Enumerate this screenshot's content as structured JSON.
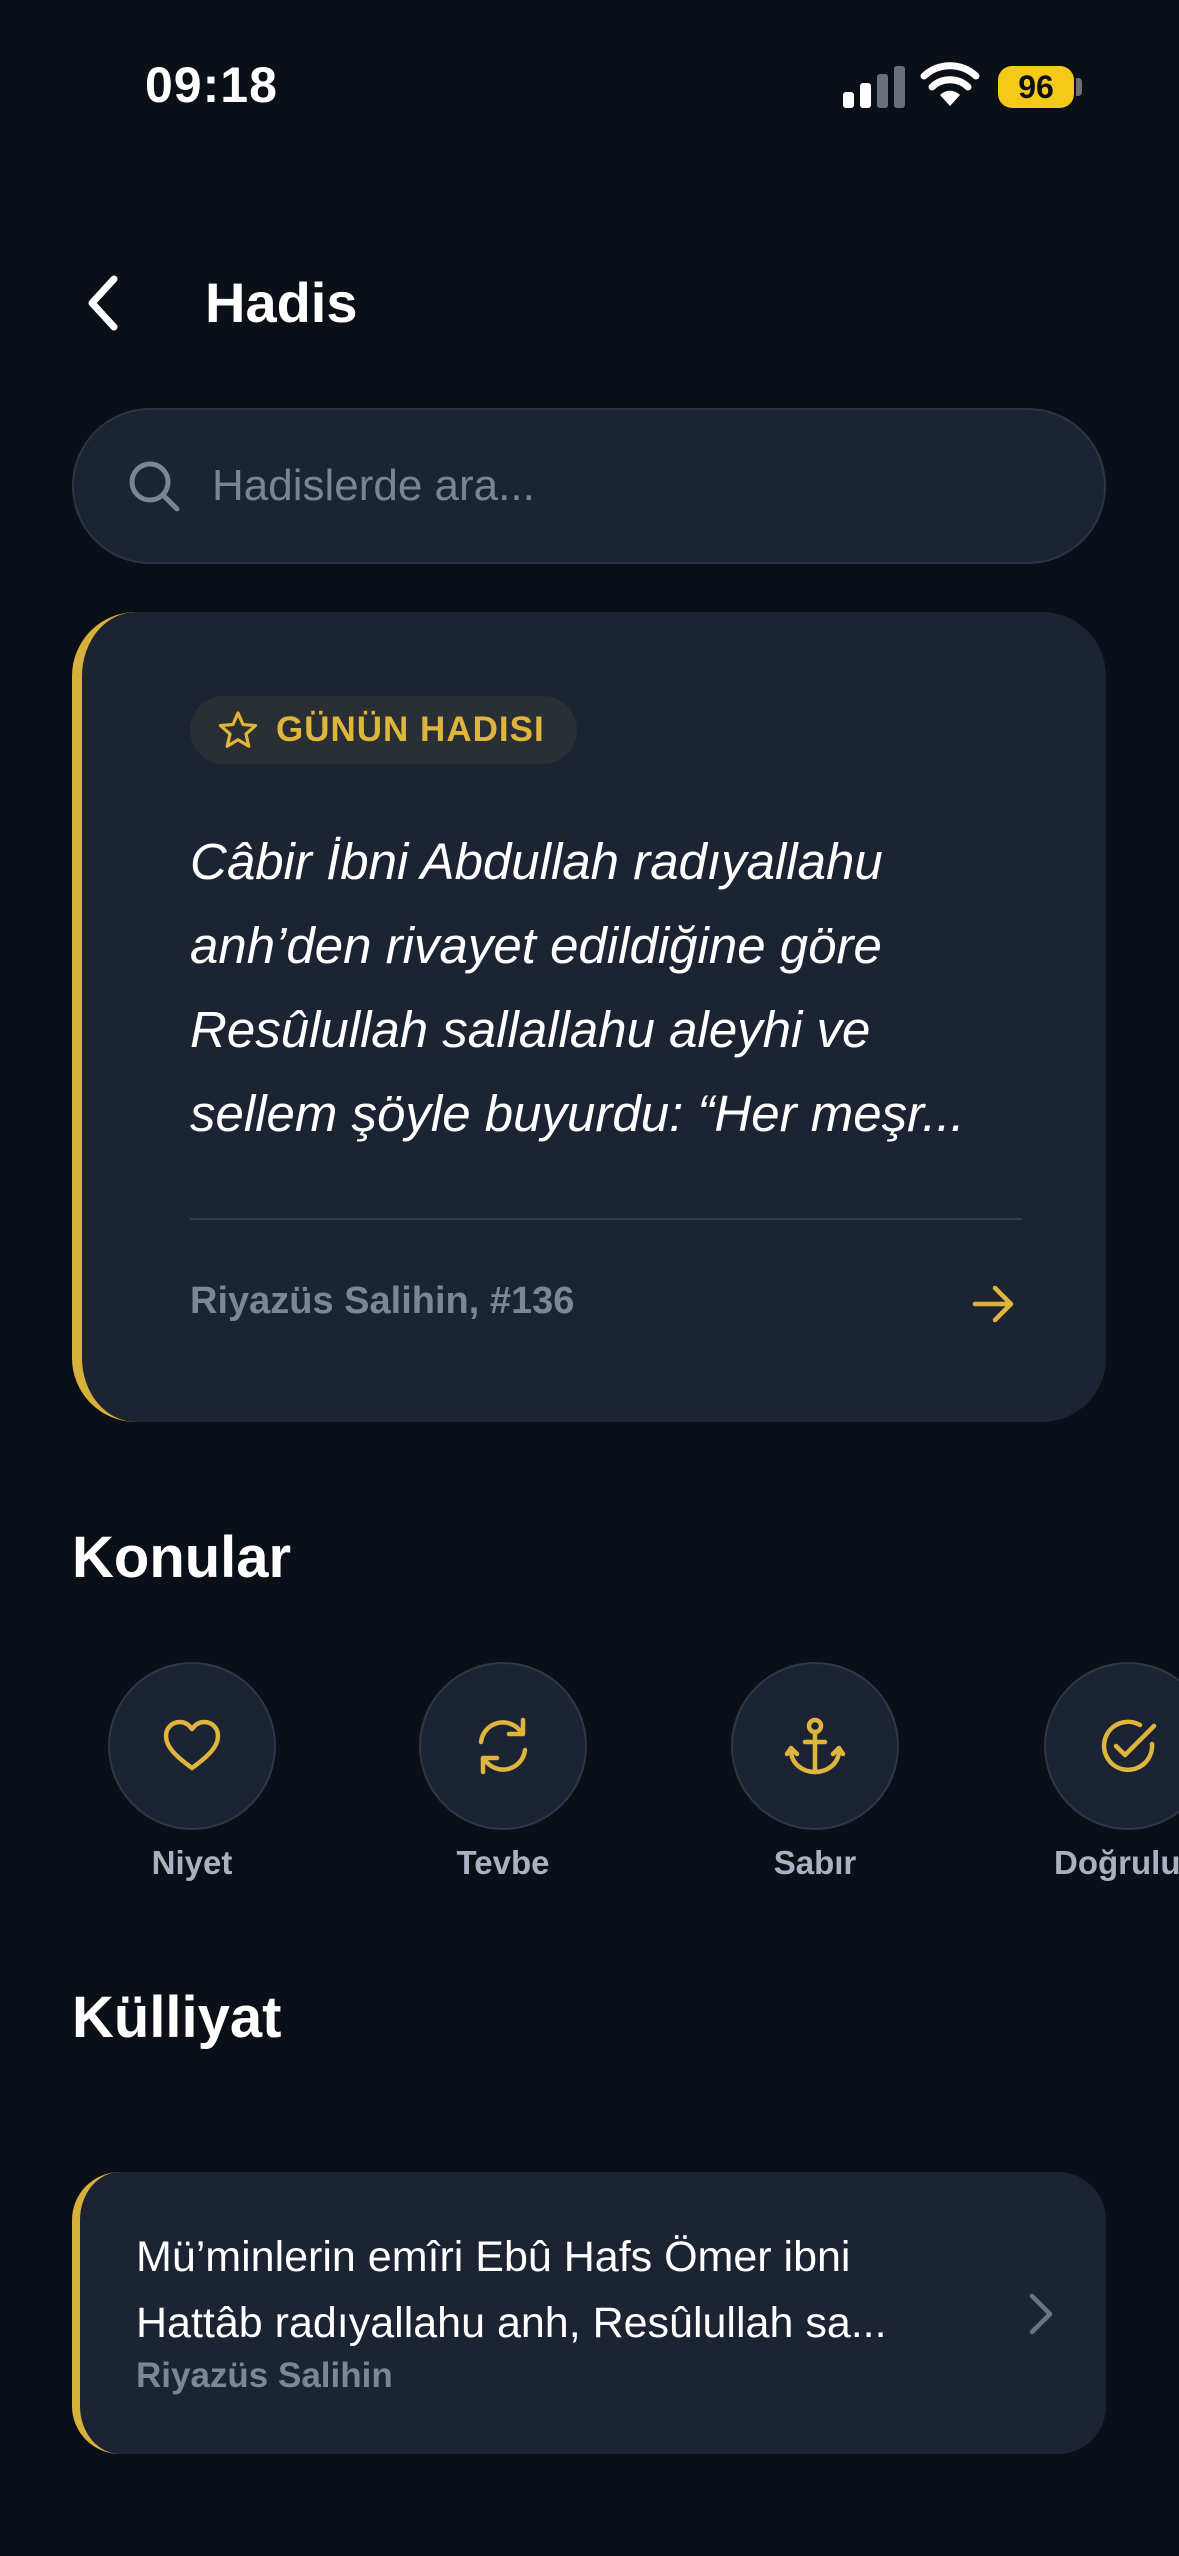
{
  "status_bar": {
    "time": "09:18",
    "battery": "96"
  },
  "header": {
    "title": "Hadis"
  },
  "search": {
    "placeholder": "Hadislerde ara..."
  },
  "daily_hadith": {
    "badge": "GÜNÜN HADISI",
    "line1": "Câbir İbni Abdullah radıyallahu",
    "line2": "anh’den rivayet edildiğine göre",
    "line3": "Resûlullah sallallahu aleyhi ve",
    "line4": "sellem şöyle buyurdu: “Her meşr...",
    "source": "Riyazüs Salihin, #136"
  },
  "topics": {
    "title": "Konular",
    "items": [
      {
        "label": "Niyet",
        "icon": "heart-icon"
      },
      {
        "label": "Tevbe",
        "icon": "refresh-icon"
      },
      {
        "label": "Sabır",
        "icon": "anchor-icon"
      },
      {
        "label": "Doğrulu",
        "icon": "check-circle-icon"
      }
    ]
  },
  "collection": {
    "title": "Külliyat",
    "card": {
      "line1": "Mü’minlerin emîri Ebû Hafs Ömer ibni",
      "line2": "Hattâb radıyallahu anh, Resûlullah sa...",
      "source": "Riyazüs Salihin"
    }
  },
  "colors": {
    "background": "#0b0f17",
    "card": "#1c2433",
    "accent": "#d7b13a",
    "battery": "#f4c91a"
  }
}
